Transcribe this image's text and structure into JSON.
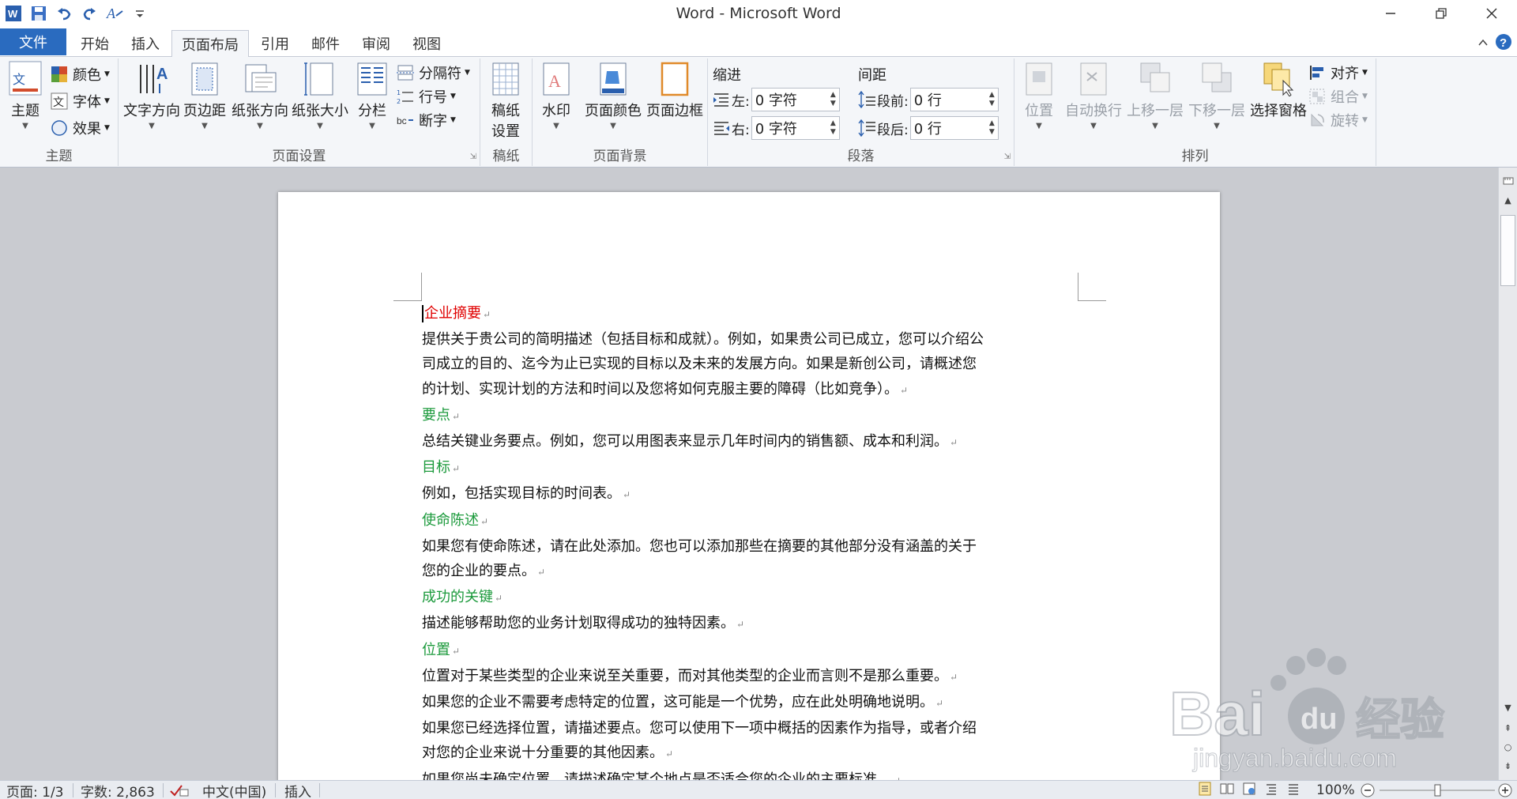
{
  "window": {
    "title": "Word - Microsoft Word"
  },
  "tabs": [
    "开始",
    "插入",
    "页面布局",
    "引用",
    "邮件",
    "审阅",
    "视图"
  ],
  "file_tab": "文件",
  "active_tab": "页面布局",
  "ribbon": {
    "theme": {
      "group": "主题",
      "big": "主题",
      "colors": "颜色",
      "fonts": "字体",
      "effects": "效果"
    },
    "page_setup": {
      "group": "页面设置",
      "text_direction": "文字方向",
      "margins": "页边距",
      "orientation": "纸张方向",
      "size": "纸张大小",
      "columns": "分栏",
      "breaks": "分隔符",
      "line_numbers": "行号",
      "hyphenation": "断字"
    },
    "manuscript": {
      "group": "稿纸",
      "big_line1": "稿纸",
      "big_line2": "设置"
    },
    "page_background": {
      "group": "页面背景",
      "watermark": "水印",
      "page_color": "页面颜色",
      "page_borders": "页面边框"
    },
    "paragraph": {
      "group": "段落",
      "indent_label": "缩进",
      "spacing_label": "间距",
      "left_label": "左:",
      "right_label": "右:",
      "before_label": "段前:",
      "after_label": "段后:",
      "left_value": "0 字符",
      "right_value": "0 字符",
      "before_value": "0 行",
      "after_value": "0 行"
    },
    "arrange": {
      "group": "排列",
      "position": "位置",
      "wrap_text": "自动换行",
      "bring_forward": "上移一层",
      "send_backward": "下移一层",
      "selection_pane": "选择窗格",
      "align": "对齐",
      "group_btn": "组合",
      "rotate": "旋转"
    }
  },
  "document": {
    "blocks": [
      {
        "type": "heading-red",
        "text": "企业摘要"
      },
      {
        "type": "para",
        "text": "提供关于贵公司的简明描述（包括目标和成就）。例如，如果贵公司已成立，您可以介绍公"
      },
      {
        "type": "para",
        "text": "司成立的目的、迄今为止已实现的目标以及未来的发展方向。如果是新创公司，请概述您"
      },
      {
        "type": "para",
        "text": "的计划、实现计划的方法和时间以及您将如何克服主要的障碍（比如竞争）。"
      },
      {
        "type": "heading-green",
        "text": "要点"
      },
      {
        "type": "para",
        "text": "总结关键业务要点。例如，您可以用图表来显示几年时间内的销售额、成本和利润。"
      },
      {
        "type": "heading-green",
        "text": "目标"
      },
      {
        "type": "para",
        "text": "例如，包括实现目标的时间表。"
      },
      {
        "type": "heading-green",
        "text": "使命陈述"
      },
      {
        "type": "para",
        "text": "如果您有使命陈述，请在此处添加。您也可以添加那些在摘要的其他部分没有涵盖的关于"
      },
      {
        "type": "para",
        "text": "您的企业的要点。"
      },
      {
        "type": "heading-green",
        "text": "成功的关键"
      },
      {
        "type": "para",
        "text": "描述能够帮助您的业务计划取得成功的独特因素。"
      },
      {
        "type": "heading-green",
        "text": "位置"
      },
      {
        "type": "para",
        "text": "位置对于某些类型的企业来说至关重要，而对其他类型的企业而言则不是那么重要。"
      },
      {
        "type": "para",
        "text": "如果您的企业不需要考虑特定的位置，这可能是一个优势，应在此处明确地说明。"
      },
      {
        "type": "para",
        "text": "如果您已经选择位置，请描述要点。您可以使用下一项中概括的因素作为指导，或者介绍"
      },
      {
        "type": "para",
        "text": "对您的企业来说十分重要的其他因素。"
      },
      {
        "type": "para",
        "text": "如果您尚未确定位置，请描述确定某个地点是否适合您的企业的主要标准。"
      }
    ]
  },
  "status": {
    "page": "页面: 1/3",
    "words": "字数: 2,863",
    "language": "中文(中国)",
    "mode": "插入",
    "zoom": "100%"
  },
  "watermark": {
    "brand": "Bai du 经验",
    "url": "jingyan.baidu.com"
  },
  "colors": {
    "file_tab": "#2a6bbf",
    "heading_red": "#e00000",
    "heading_green": "#1c9a3c"
  }
}
